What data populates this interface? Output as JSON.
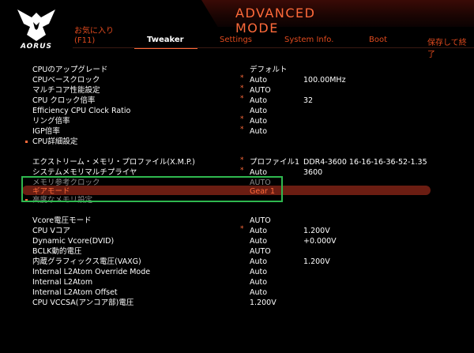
{
  "brand": "AORUS",
  "mode_title": "ADVANCED MODE",
  "tabs": {
    "favorites_line1": "お気に入り",
    "favorites_line2": "(F11)",
    "tweaker": "Tweaker",
    "settings": "Settings",
    "system_info": "System Info.",
    "boot": "Boot",
    "save_exit": "保存して終了"
  },
  "rows": [
    {
      "name": "CPUのアップグレード",
      "star": "",
      "value": "デフォルト",
      "value2": ""
    },
    {
      "name": "CPUベースクロック",
      "star": "*",
      "value": "Auto",
      "value2": "100.00MHz"
    },
    {
      "name": "マルチコア性能設定",
      "star": "*",
      "value": "AUTO",
      "value2": ""
    },
    {
      "name": "CPU クロック倍率",
      "star": "*",
      "value": "Auto",
      "value2": "32"
    },
    {
      "name": "Efficiency CPU Clock Ratio",
      "star": "",
      "value": "Auto",
      "value2": ""
    },
    {
      "name": "リング倍率",
      "star": "*",
      "value": "Auto",
      "value2": ""
    },
    {
      "name": "IGP倍率",
      "star": "*",
      "value": "Auto",
      "value2": ""
    },
    {
      "name": "CPU詳細設定",
      "star": "",
      "value": "",
      "value2": ""
    },
    {
      "name": "エクストリーム・メモリ・プロファイル(X.M.P.)",
      "star": "*",
      "value": "プロファイル1",
      "value2": "DDR4-3600 16-16-16-36-52-1.35"
    },
    {
      "name": "システムメモリマルチプライヤ",
      "star": "*",
      "value": "Auto",
      "value2": "3600"
    },
    {
      "name": "メモリ参考クロック",
      "star": "",
      "value": "AUTO",
      "value2": ""
    },
    {
      "name": "ギアモード",
      "star": "",
      "value": "Gear 1",
      "value2": ""
    },
    {
      "name": "高度なメモリ設定",
      "star": "",
      "value": "",
      "value2": ""
    },
    {
      "name": "Vcore電圧モード",
      "star": "",
      "value": "AUTO",
      "value2": ""
    },
    {
      "name": "CPU Vコア",
      "star": "*",
      "value": "Auto",
      "value2": "1.200V"
    },
    {
      "name": "Dynamic Vcore(DVID)",
      "star": "",
      "value": "Auto",
      "value2": "+0.000V"
    },
    {
      "name": "BCLK動的電圧",
      "star": "",
      "value": "AUTO",
      "value2": ""
    },
    {
      "name": "内蔵グラフィックス電圧(VAXG)",
      "star": "",
      "value": "Auto",
      "value2": "1.200V"
    },
    {
      "name": "Internal L2Atom Override Mode",
      "star": "",
      "value": "Auto",
      "value2": ""
    },
    {
      "name": "Internal L2Atom",
      "star": "",
      "value": "Auto",
      "value2": ""
    },
    {
      "name": "Internal L2Atom Offset",
      "star": "",
      "value": "Auto",
      "value2": ""
    },
    {
      "name": "CPU VCCSA(アンコア部)電圧",
      "star": "",
      "value": "1.200V",
      "value2": ""
    }
  ],
  "colors": {
    "accent": "#ff6a3a",
    "highlight_bar": "#6b1d12",
    "selection_box": "#2fb84f"
  }
}
